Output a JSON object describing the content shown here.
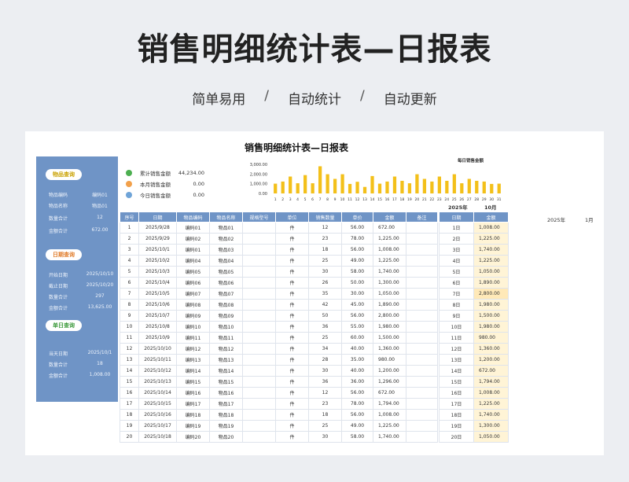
{
  "hero": {
    "title": "销售明细统计表—日报表",
    "sub": [
      "简单易用",
      "自动统计",
      "自动更新"
    ],
    "sep": "/"
  },
  "sheet": {
    "title": "销售明细统计表—日报表"
  },
  "sidebar": {
    "item_query": {
      "label": "物品查询",
      "rows": [
        [
          "物品编码",
          "编码01"
        ],
        [
          "物品名称",
          "物品01"
        ],
        [
          "数量合计",
          "12"
        ],
        [
          "金额合计",
          "672.00"
        ]
      ]
    },
    "date_query": {
      "label": "日期查询",
      "rows": [
        [
          "开始日期",
          "2025/10/10"
        ],
        [
          "截止日期",
          "2025/10/20"
        ],
        [
          "数量合计",
          "297"
        ],
        [
          "金额合计",
          "13,625.00"
        ]
      ]
    },
    "day_query": {
      "label": "单日查询",
      "rows": [
        [
          "当天日期",
          "2025/10/1"
        ],
        [
          "数量合计",
          "18"
        ],
        [
          "金额合计",
          "1,008.00"
        ]
      ]
    }
  },
  "stats": [
    {
      "label": "累计销售金额",
      "value": "44,234.00",
      "color": "#4caf50"
    },
    {
      "label": "本月销售金额",
      "value": "0.00",
      "color": "#f2a04a"
    },
    {
      "label": "今日销售金额",
      "value": "0.00",
      "color": "#6fa4d8"
    }
  ],
  "chart_data": {
    "type": "bar",
    "title": "每日销售金额",
    "categories": [
      "1",
      "2",
      "3",
      "4",
      "5",
      "6",
      "7",
      "8",
      "9",
      "10",
      "11",
      "12",
      "13",
      "14",
      "15",
      "16",
      "17",
      "18",
      "19",
      "20",
      "21",
      "22",
      "23",
      "24",
      "25",
      "26",
      "27",
      "28",
      "29",
      "30",
      "31"
    ],
    "values": [
      1008,
      1225,
      1740,
      1050,
      1890,
      1050,
      2800,
      1980,
      1500,
      1980,
      980,
      1200,
      672,
      1794,
      1008,
      1225,
      1740,
      1300,
      1050,
      1980,
      1500,
      1225,
      1740,
      1300,
      1980,
      1050,
      1500,
      1300,
      1225,
      980,
      1008
    ],
    "yticks": [
      "3,000.00",
      "2,000.00",
      "1,000.00",
      "0.00"
    ],
    "ylim": [
      0,
      3000
    ],
    "color": "#f3c01a"
  },
  "month_header": {
    "year": "2025年",
    "month": "10月"
  },
  "month_header2": {
    "year": "2025年",
    "month": "1月"
  },
  "table": {
    "headers": [
      "序号",
      "日期",
      "物品编码",
      "物品名称",
      "规格型号",
      "单位",
      "销售数量",
      "单价",
      "金额",
      "备注"
    ],
    "rows": [
      [
        "1",
        "2025/9/28",
        "编码01",
        "物品01",
        "",
        "件",
        "12",
        "56.00",
        "672.00",
        ""
      ],
      [
        "2",
        "2025/9/29",
        "编码02",
        "物品02",
        "",
        "件",
        "23",
        "78.00",
        "1,225.00",
        ""
      ],
      [
        "3",
        "2025/10/1",
        "编码01",
        "物品03",
        "",
        "件",
        "18",
        "56.00",
        "1,008.00",
        ""
      ],
      [
        "4",
        "2025/10/2",
        "编码04",
        "物品04",
        "",
        "件",
        "25",
        "49.00",
        "1,225.00",
        ""
      ],
      [
        "5",
        "2025/10/3",
        "编码05",
        "物品05",
        "",
        "件",
        "30",
        "58.00",
        "1,740.00",
        ""
      ],
      [
        "6",
        "2025/10/4",
        "编码06",
        "物品06",
        "",
        "件",
        "26",
        "50.00",
        "1,300.00",
        ""
      ],
      [
        "7",
        "2025/10/5",
        "编码07",
        "物品07",
        "",
        "件",
        "35",
        "30.00",
        "1,050.00",
        ""
      ],
      [
        "8",
        "2025/10/6",
        "编码08",
        "物品08",
        "",
        "件",
        "42",
        "45.00",
        "1,890.00",
        ""
      ],
      [
        "9",
        "2025/10/7",
        "编码09",
        "物品09",
        "",
        "件",
        "50",
        "56.00",
        "2,800.00",
        ""
      ],
      [
        "10",
        "2025/10/8",
        "编码10",
        "物品10",
        "",
        "件",
        "36",
        "55.00",
        "1,980.00",
        ""
      ],
      [
        "11",
        "2025/10/9",
        "编码11",
        "物品11",
        "",
        "件",
        "25",
        "60.00",
        "1,500.00",
        ""
      ],
      [
        "12",
        "2025/10/10",
        "编码12",
        "物品12",
        "",
        "件",
        "34",
        "40.00",
        "1,360.00",
        ""
      ],
      [
        "13",
        "2025/10/11",
        "编码13",
        "物品13",
        "",
        "件",
        "28",
        "35.00",
        "980.00",
        ""
      ],
      [
        "14",
        "2025/10/12",
        "编码14",
        "物品14",
        "",
        "件",
        "30",
        "40.00",
        "1,200.00",
        ""
      ],
      [
        "15",
        "2025/10/13",
        "编码15",
        "物品15",
        "",
        "件",
        "36",
        "36.00",
        "1,296.00",
        ""
      ],
      [
        "16",
        "2025/10/14",
        "编码16",
        "物品16",
        "",
        "件",
        "12",
        "56.00",
        "672.00",
        ""
      ],
      [
        "17",
        "2025/10/15",
        "编码17",
        "物品17",
        "",
        "件",
        "23",
        "78.00",
        "1,794.00",
        ""
      ],
      [
        "18",
        "2025/10/16",
        "编码18",
        "物品18",
        "",
        "件",
        "18",
        "56.00",
        "1,008.00",
        ""
      ],
      [
        "19",
        "2025/10/17",
        "编码19",
        "物品19",
        "",
        "件",
        "25",
        "49.00",
        "1,225.00",
        ""
      ],
      [
        "20",
        "2025/10/18",
        "编码20",
        "物品20",
        "",
        "件",
        "30",
        "58.00",
        "1,740.00",
        ""
      ]
    ]
  },
  "daily": {
    "headers": [
      "日期",
      "金额"
    ],
    "rows": [
      [
        "1日",
        "1,008.00"
      ],
      [
        "2日",
        "1,225.00"
      ],
      [
        "3日",
        "1,740.00"
      ],
      [
        "4日",
        "1,225.00"
      ],
      [
        "5日",
        "1,050.00"
      ],
      [
        "6日",
        "1,890.00"
      ],
      [
        "7日",
        "2,800.00"
      ],
      [
        "8日",
        "1,980.00"
      ],
      [
        "9日",
        "1,500.00"
      ],
      [
        "10日",
        "1,980.00"
      ],
      [
        "11日",
        "980.00"
      ],
      [
        "12日",
        "1,360.00"
      ],
      [
        "13日",
        "1,200.00"
      ],
      [
        "14日",
        "672.00"
      ],
      [
        "15日",
        "1,794.00"
      ],
      [
        "16日",
        "1,008.00"
      ],
      [
        "17日",
        "1,225.00"
      ],
      [
        "18日",
        "1,740.00"
      ],
      [
        "19日",
        "1,300.00"
      ],
      [
        "20日",
        "1,050.00"
      ]
    ]
  }
}
